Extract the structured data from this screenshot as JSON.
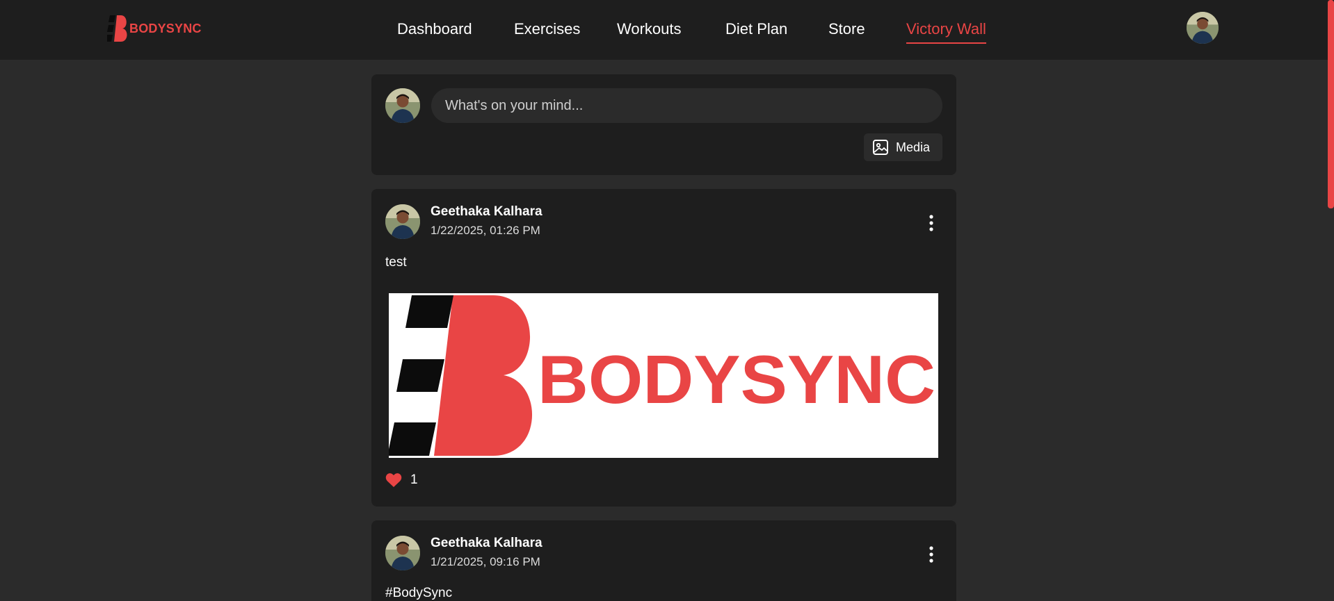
{
  "brand": {
    "name": "BODYSYNC",
    "accent_color": "#e94545"
  },
  "nav": {
    "items": [
      {
        "label": "Dashboard"
      },
      {
        "label": "Exercises"
      },
      {
        "label": "Workouts"
      },
      {
        "label": "Diet Plan"
      },
      {
        "label": "Store"
      },
      {
        "label": "Victory Wall",
        "active": true
      }
    ]
  },
  "composer": {
    "placeholder": "What's on your mind...",
    "media_label": "Media",
    "media_icon": "image-icon"
  },
  "posts": [
    {
      "author": "Geethaka Kalhara",
      "timestamp": "1/22/2025, 01:26 PM",
      "text": "test",
      "image_text": "BODYSYNC",
      "likes": "1",
      "liked": true
    },
    {
      "author": "Geethaka Kalhara",
      "timestamp": "1/21/2025, 09:16 PM",
      "text": "#BodySync"
    }
  ]
}
